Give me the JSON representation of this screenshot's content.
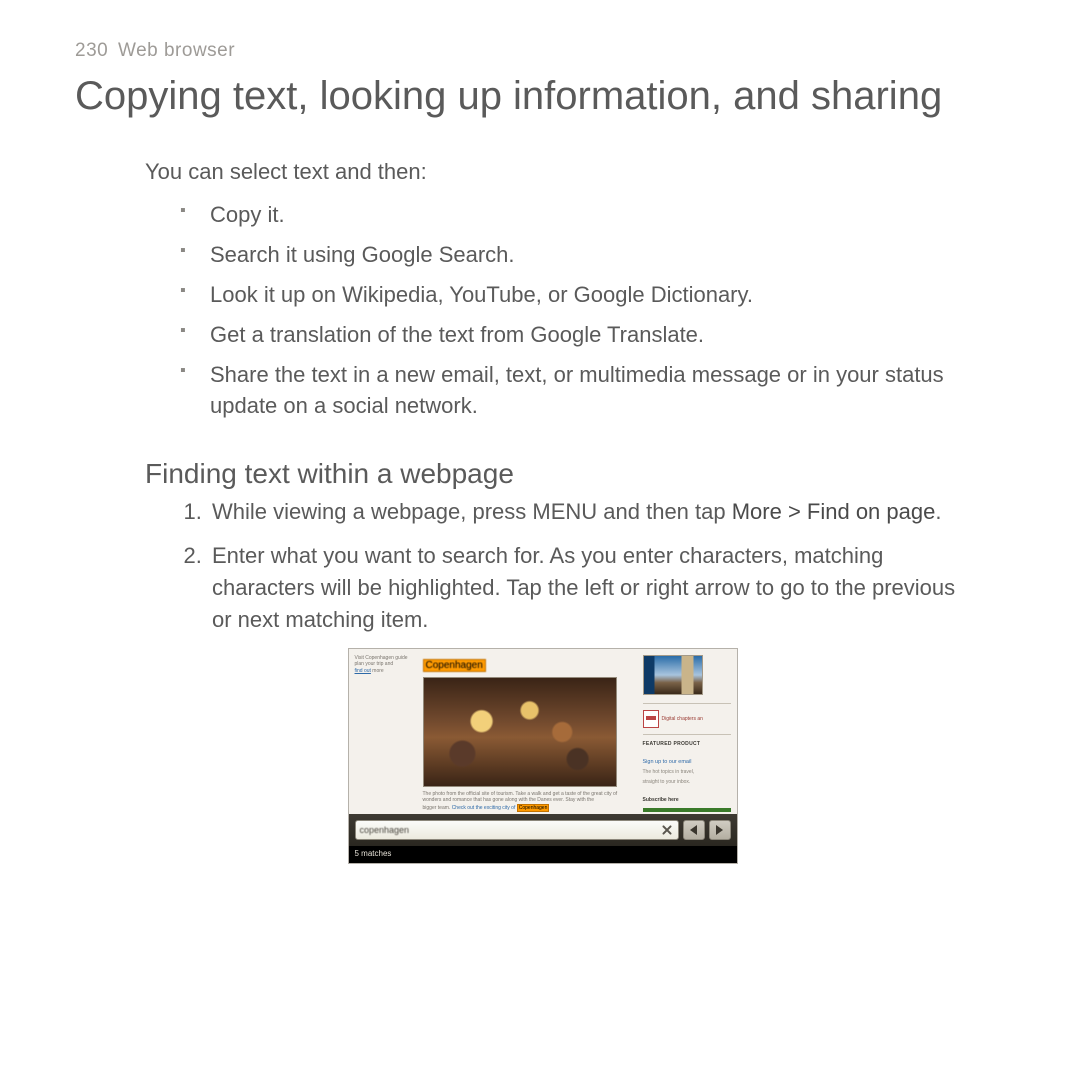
{
  "header": {
    "page_number": "230",
    "section": "Web browser"
  },
  "title": "Copying text, looking up information, and sharing",
  "intro": "You can select text and then:",
  "bullets": [
    "Copy it.",
    "Search it using Google Search.",
    "Look it up on Wikipedia, YouTube, or Google Dictionary.",
    "Get a translation of the text from Google Translate.",
    "Share the text in a new email, text, or multimedia message or in your status update on a social network."
  ],
  "subhead": "Finding text within a webpage",
  "steps": {
    "s1_a": "While viewing a webpage, press MENU and then tap ",
    "s1_b": "More > Find on page",
    "s1_c": ".",
    "s2": "Enter what you want to search for. As you enter characters, matching characters will be highlighted. Tap the left or right arrow to go to the previous or next matching item."
  },
  "screenshot": {
    "highlight_word": "Copenhagen",
    "left_blurb_a": "Visit Copenhagen guide",
    "left_blurb_b": "plan your trip and",
    "left_blurb_link": "find out",
    "left_blurb_c": "more",
    "caption_a": "The photo from the official site of tourism. Take a walk and get a taste of the great city of",
    "caption_b": "wonders and romance that has gone along with the Danes ever. Stay with the",
    "caption_c": "bigger team.",
    "caption_link": "Check out the exciting city of",
    "right_pdf": "Digital chapters an",
    "right_head": "FEATURED PRODUCT",
    "right_link": "Sign up to our email",
    "right_g1": "The hot topics in travel,",
    "right_g2": "straight to your inbox.",
    "right_btn": "Subscribe here",
    "find_value": "copenhagen",
    "matches": "5 matches"
  }
}
